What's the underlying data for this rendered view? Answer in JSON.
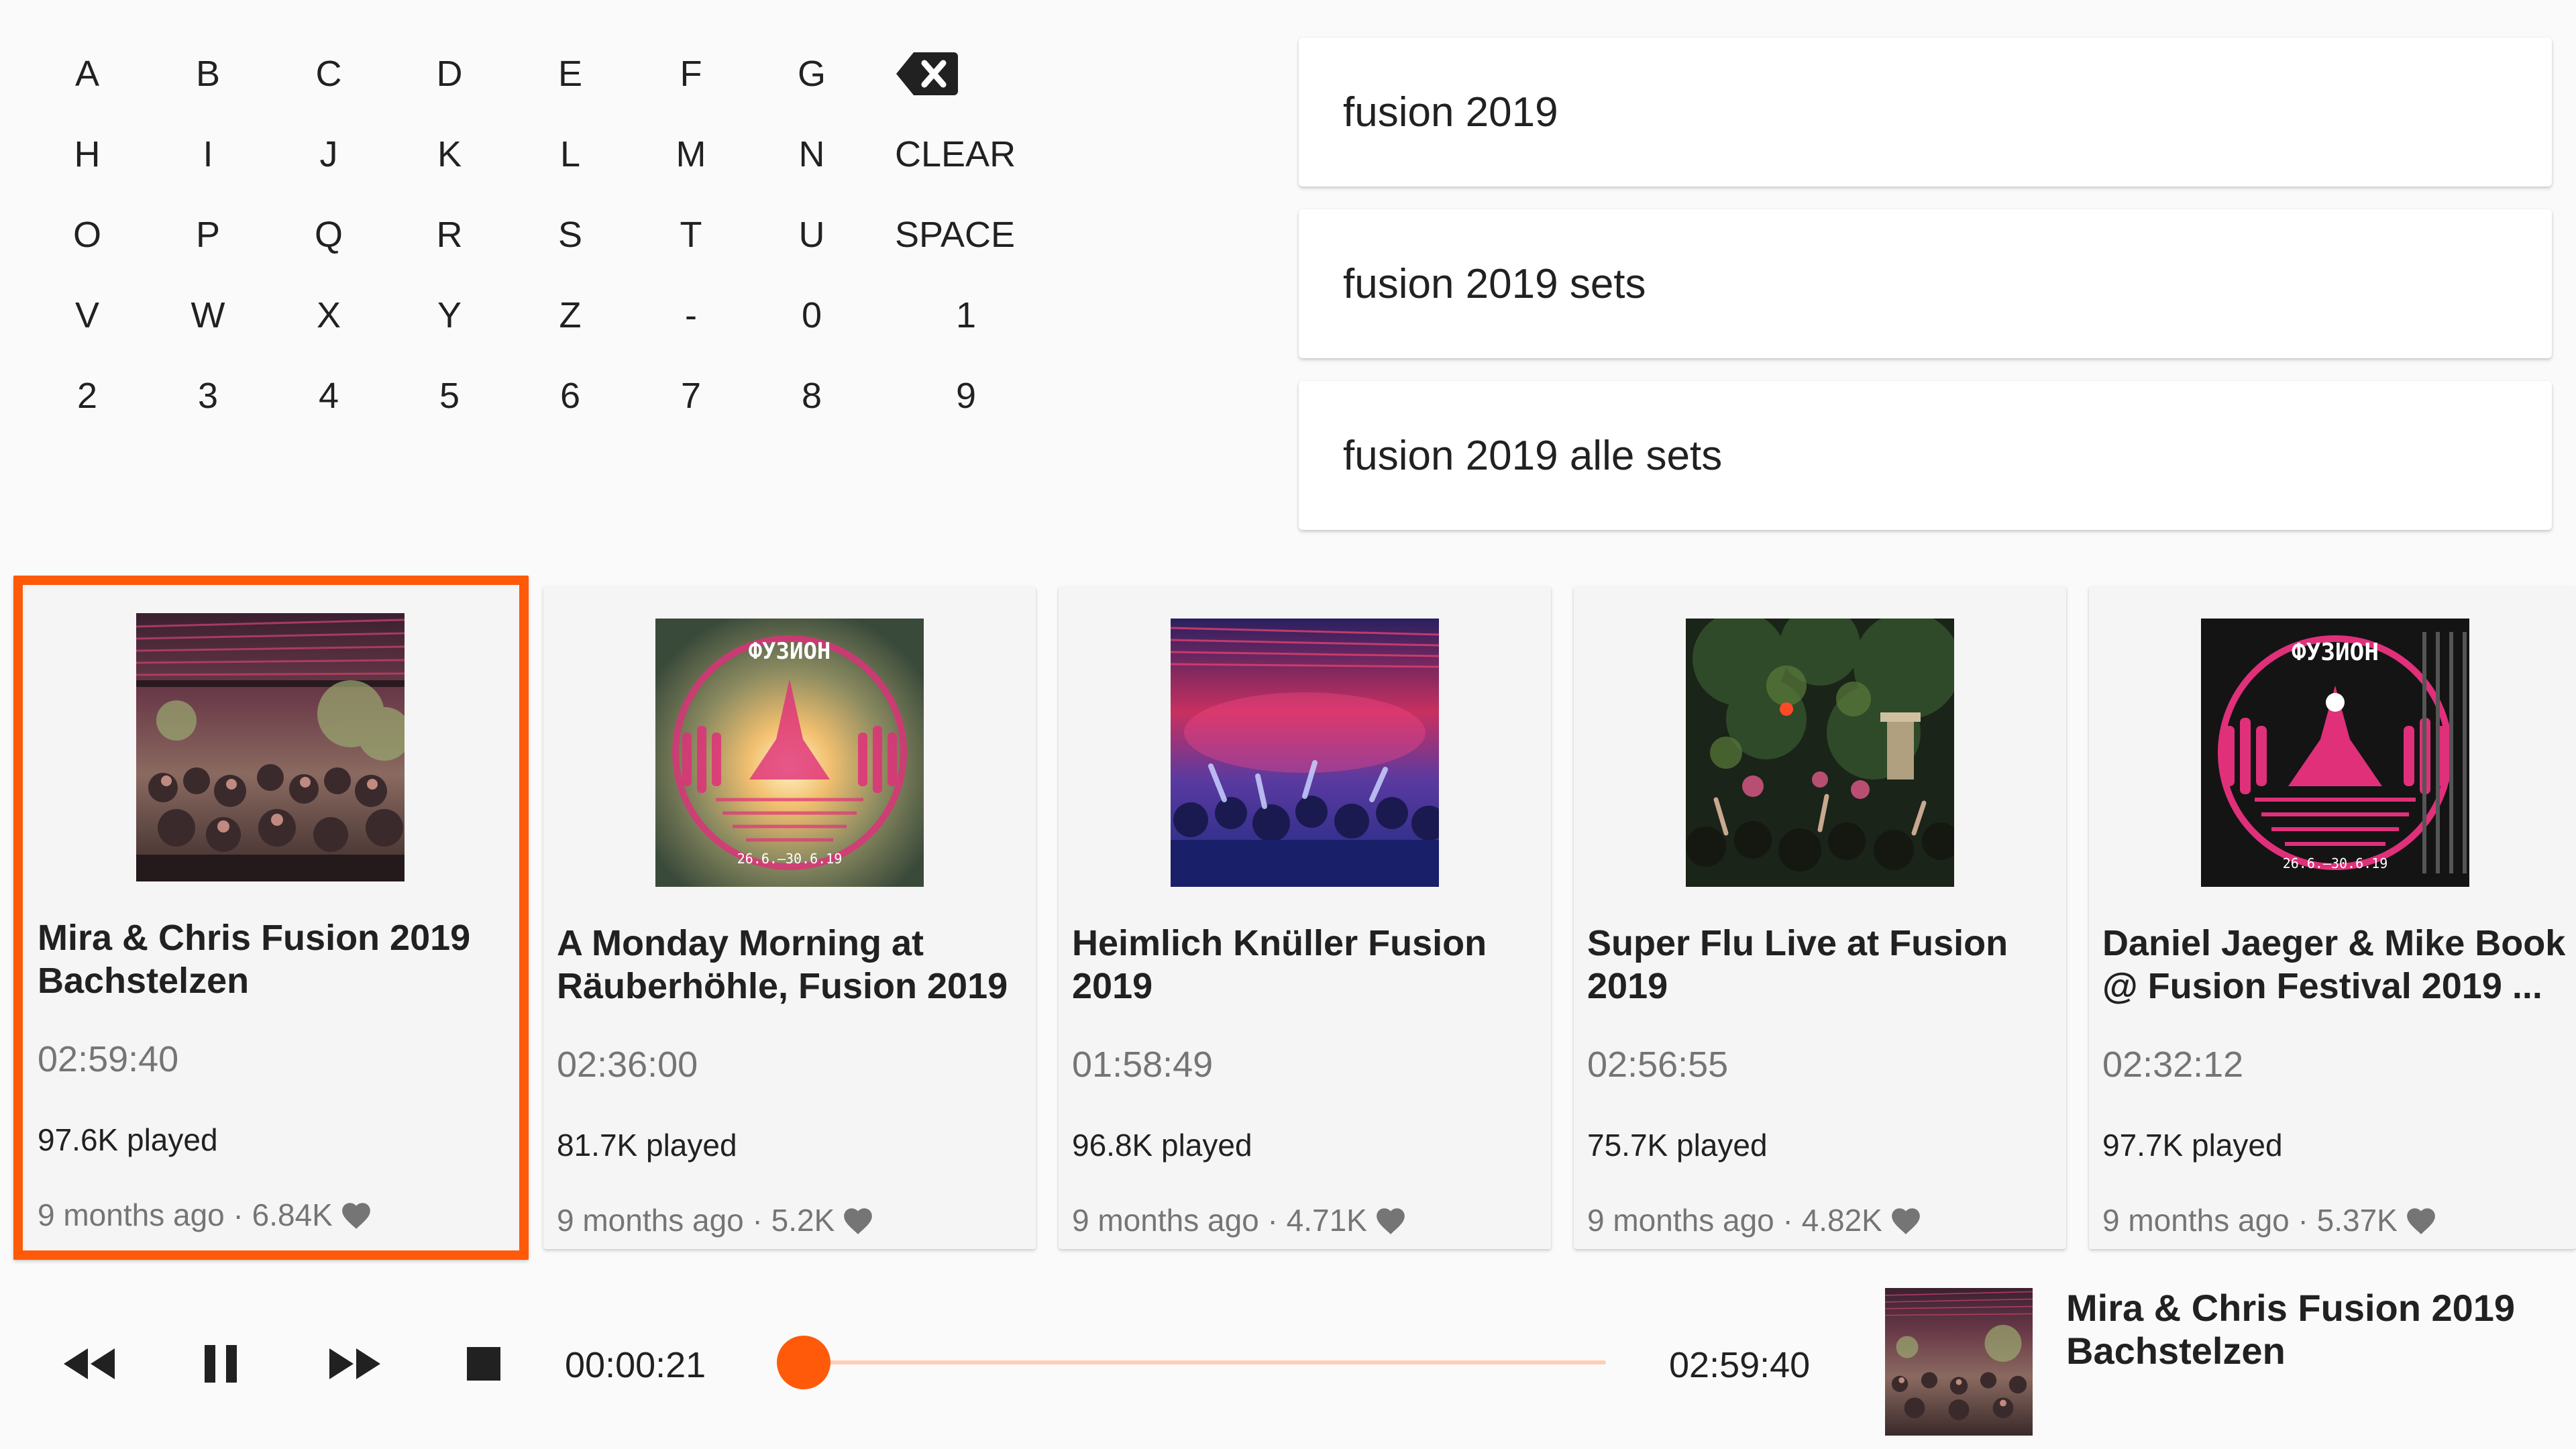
{
  "keyboard": {
    "rows": [
      [
        "A",
        "B",
        "C",
        "D",
        "E",
        "F",
        "G"
      ],
      [
        "H",
        "I",
        "J",
        "K",
        "L",
        "M",
        "N"
      ],
      [
        "O",
        "P",
        "Q",
        "R",
        "S",
        "T",
        "U"
      ],
      [
        "V",
        "W",
        "X",
        "Y",
        "Z",
        "-",
        "0",
        "1"
      ],
      [
        "2",
        "3",
        "4",
        "5",
        "6",
        "7",
        "8",
        "9"
      ]
    ],
    "clear_label": "CLEAR",
    "space_label": "SPACE"
  },
  "suggestions": [
    "fusion 2019",
    "fusion 2019 sets",
    "fusion 2019 alle sets"
  ],
  "cards": [
    {
      "title": "Mira & Chris Fusion 2019 Bachstelzen",
      "duration": "02:59:40",
      "plays": "97.6K played",
      "meta": "9 months ago · 6.84K"
    },
    {
      "title": "A Monday Morning at Räuberhöhle, Fusion 2019",
      "duration": "02:36:00",
      "plays": "81.7K played",
      "meta": "9 months ago · 5.2K",
      "thumb_text": "26.6.–30.6.19"
    },
    {
      "title": "Heimlich Knüller Fusion 2019",
      "duration": "01:58:49",
      "plays": "96.8K played",
      "meta": "9 months ago · 4.71K"
    },
    {
      "title": "Super Flu Live at Fusion 2019",
      "duration": "02:56:55",
      "plays": "75.7K played",
      "meta": "9 months ago · 4.82K"
    },
    {
      "title": "Daniel Jaeger & Mike Book @ Fusion Festival 2019 ...",
      "duration": "02:32:12",
      "plays": "97.7K played",
      "meta": "9 months ago · 5.37K",
      "thumb_text": "26.6.–30.6.19"
    }
  ],
  "player": {
    "elapsed": "00:00:21",
    "total": "02:59:40",
    "progress": 0.02,
    "now_playing_title": "Mira & Chris Fusion 2019 Bachstelzen"
  },
  "colors": {
    "accent": "#ff5a0a",
    "track": "#ffcdb5",
    "card_bg": "#f5f5f5",
    "muted_text": "#757575"
  },
  "icons": [
    "backspace-icon",
    "rewind-icon",
    "pause-icon",
    "fast-forward-icon",
    "stop-icon",
    "heart-icon"
  ]
}
